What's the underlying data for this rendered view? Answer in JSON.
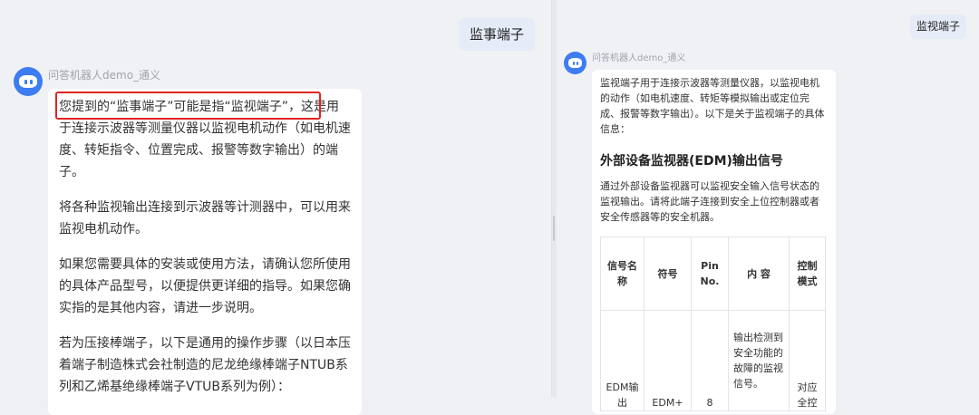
{
  "left": {
    "user_message": "监事端子",
    "bot_name": "问答机器人demo_通义",
    "paragraphs": [
      "您提到的“监事端子”可能是指“监视端子”，这是用于连接示波器等测量仪器以监视电机动作（如电机速度、转矩指令、位置完成、报警等数字输出）的端子。",
      "将各种监视输出连接到示波器等计测器中，可以用来监视电机动作。",
      "如果您需要具体的安装或使用方法，请确认您所使用的具体产品型号，以便提供更详细的指导。如果您确实指的是其他内容，请进一步说明。",
      "若为压接棒端子，以下是通用的操作步骤（以日本压着端子制造株式会社制造的尼龙绝缘棒端子NTUB系列和乙烯基绝缘棒端子VTUB系列为例）："
    ]
  },
  "right": {
    "user_message": "监视端子",
    "bot_name": "问答机器人demo_通义",
    "intro": "监视端子用于连接示波器等测量仪器，以监视电机的动作（如电机速度、转矩等模拟输出或定位完成、报警等数字输出）。以下是关于监视端子的具体信息：",
    "heading": "外部设备监视器(EDM)输出信号",
    "body": "通过外部设备监视器可以监视安全输入信号状态的监视输出。请将此端子连接到安全上位控制器或者安全传感器等的安全机器。",
    "table": {
      "headers": [
        "信号名称",
        "符号",
        "Pin No.",
        "内 容",
        "控制模式"
      ],
      "row": [
        "EDM输出",
        "EDM+",
        "8",
        "输出检测到安全功能的故障的监视信号。",
        "对应全控"
      ]
    }
  }
}
